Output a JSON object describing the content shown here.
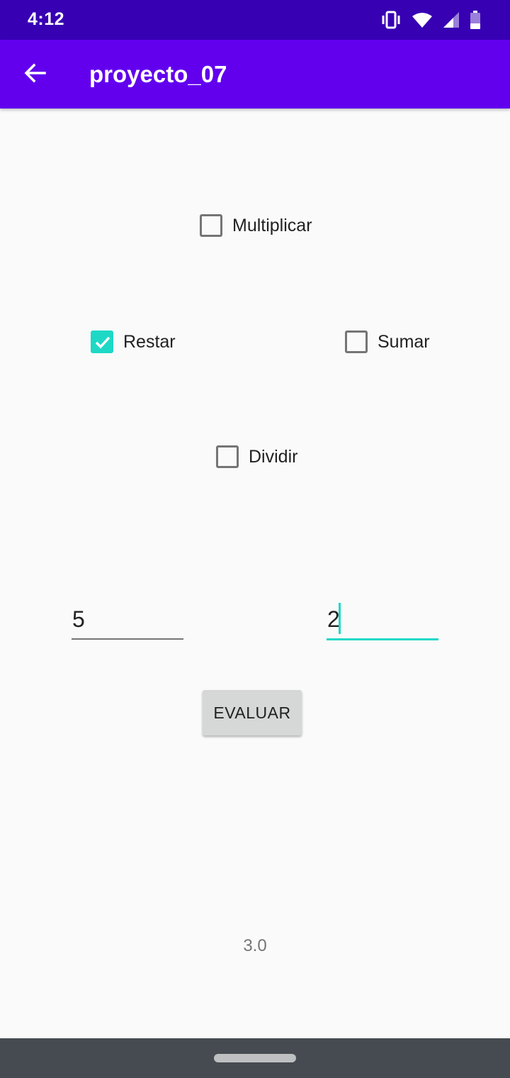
{
  "status": {
    "time": "4:12"
  },
  "app_bar": {
    "title": "proyecto_07"
  },
  "checks": {
    "multiplicar": {
      "label": "Multiplicar",
      "checked": false
    },
    "restar": {
      "label": "Restar",
      "checked": true
    },
    "sumar": {
      "label": "Sumar",
      "checked": false
    },
    "dividir": {
      "label": "Dividir",
      "checked": false
    }
  },
  "inputs": {
    "first_value": "5",
    "second_value": "2"
  },
  "button": {
    "label": "EVALUAR"
  },
  "result": "3.0",
  "colors": {
    "status_bar": "#3700b3",
    "app_bar": "#6200ee",
    "accent": "#1ed8c6"
  },
  "icons": [
    "vibrate-icon",
    "wifi-icon",
    "signal-icon",
    "battery-icon",
    "back-arrow-icon",
    "checkmark-icon"
  ]
}
